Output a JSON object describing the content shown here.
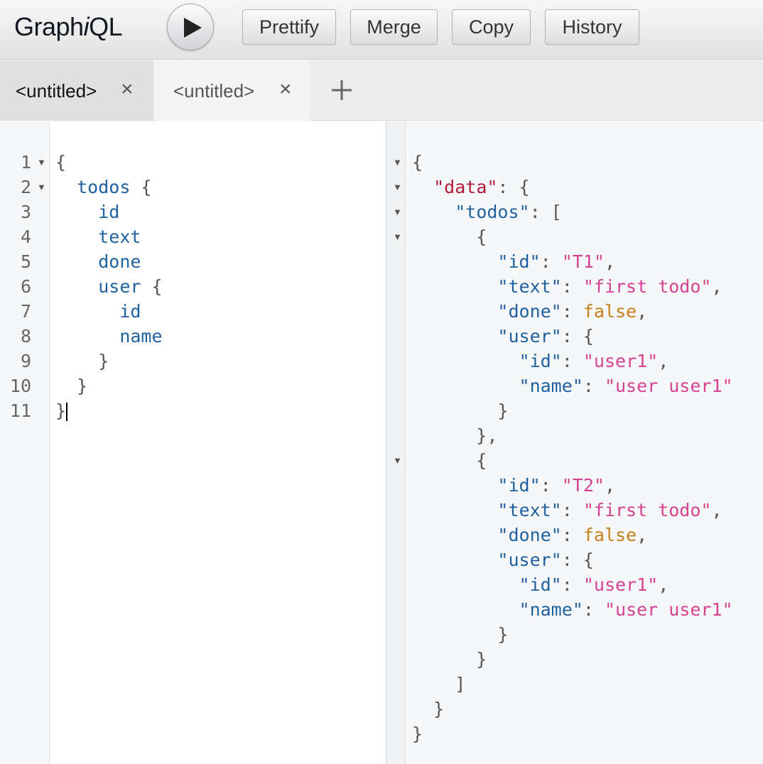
{
  "app": {
    "logo_main": "Graph",
    "logo_i": "i",
    "logo_end": "QL"
  },
  "toolbar": {
    "run_icon": "play-icon",
    "buttons": [
      {
        "label": "Prettify"
      },
      {
        "label": "Merge"
      },
      {
        "label": "Copy"
      },
      {
        "label": "History"
      }
    ]
  },
  "tabs": [
    {
      "label": "<untitled>",
      "close": "×",
      "active": true
    },
    {
      "label": "<untitled>",
      "close": "×",
      "active": false
    }
  ],
  "add_tab_icon": "plus-icon",
  "query_editor": {
    "lines": [
      {
        "num": "1",
        "fold": true,
        "tokens": [
          {
            "t": "{",
            "c": "punc"
          }
        ]
      },
      {
        "num": "2",
        "fold": true,
        "tokens": [
          {
            "t": "  ",
            "c": "punc"
          },
          {
            "t": "todos",
            "c": "field"
          },
          {
            "t": " {",
            "c": "punc"
          }
        ]
      },
      {
        "num": "3",
        "fold": false,
        "tokens": [
          {
            "t": "    ",
            "c": "punc"
          },
          {
            "t": "id",
            "c": "field"
          }
        ]
      },
      {
        "num": "4",
        "fold": false,
        "tokens": [
          {
            "t": "    ",
            "c": "punc"
          },
          {
            "t": "text",
            "c": "field"
          }
        ]
      },
      {
        "num": "5",
        "fold": false,
        "tokens": [
          {
            "t": "    ",
            "c": "punc"
          },
          {
            "t": "done",
            "c": "field"
          }
        ]
      },
      {
        "num": "6",
        "fold": false,
        "tokens": [
          {
            "t": "    ",
            "c": "punc"
          },
          {
            "t": "user",
            "c": "field"
          },
          {
            "t": " {",
            "c": "punc"
          }
        ]
      },
      {
        "num": "7",
        "fold": false,
        "tokens": [
          {
            "t": "      ",
            "c": "punc"
          },
          {
            "t": "id",
            "c": "field"
          }
        ]
      },
      {
        "num": "8",
        "fold": false,
        "tokens": [
          {
            "t": "      ",
            "c": "punc"
          },
          {
            "t": "name",
            "c": "field"
          }
        ]
      },
      {
        "num": "9",
        "fold": false,
        "tokens": [
          {
            "t": "    }",
            "c": "punc"
          }
        ]
      },
      {
        "num": "10",
        "fold": false,
        "tokens": [
          {
            "t": "  }",
            "c": "punc"
          }
        ]
      },
      {
        "num": "11",
        "fold": false,
        "tokens": [
          {
            "t": "}",
            "c": "punc"
          }
        ],
        "cursor": true
      }
    ]
  },
  "result_viewer": {
    "lines": [
      {
        "fold": true,
        "tokens": [
          {
            "t": "{",
            "c": "punc"
          }
        ]
      },
      {
        "fold": true,
        "tokens": [
          {
            "t": "  ",
            "c": "punc"
          },
          {
            "t": "\"data\"",
            "c": "key-data"
          },
          {
            "t": ": {",
            "c": "punc"
          }
        ]
      },
      {
        "fold": true,
        "tokens": [
          {
            "t": "    ",
            "c": "punc"
          },
          {
            "t": "\"todos\"",
            "c": "prop"
          },
          {
            "t": ": [",
            "c": "punc"
          }
        ]
      },
      {
        "fold": true,
        "tokens": [
          {
            "t": "      {",
            "c": "punc"
          }
        ]
      },
      {
        "fold": false,
        "tokens": [
          {
            "t": "        ",
            "c": "punc"
          },
          {
            "t": "\"id\"",
            "c": "prop"
          },
          {
            "t": ": ",
            "c": "punc"
          },
          {
            "t": "\"T1\"",
            "c": "str"
          },
          {
            "t": ",",
            "c": "punc"
          }
        ]
      },
      {
        "fold": false,
        "tokens": [
          {
            "t": "        ",
            "c": "punc"
          },
          {
            "t": "\"text\"",
            "c": "prop"
          },
          {
            "t": ": ",
            "c": "punc"
          },
          {
            "t": "\"first todo\"",
            "c": "str"
          },
          {
            "t": ",",
            "c": "punc"
          }
        ]
      },
      {
        "fold": false,
        "tokens": [
          {
            "t": "        ",
            "c": "punc"
          },
          {
            "t": "\"done\"",
            "c": "prop"
          },
          {
            "t": ": ",
            "c": "punc"
          },
          {
            "t": "false",
            "c": "bool"
          },
          {
            "t": ",",
            "c": "punc"
          }
        ]
      },
      {
        "fold": false,
        "tokens": [
          {
            "t": "        ",
            "c": "punc"
          },
          {
            "t": "\"user\"",
            "c": "prop"
          },
          {
            "t": ": {",
            "c": "punc"
          }
        ]
      },
      {
        "fold": false,
        "tokens": [
          {
            "t": "          ",
            "c": "punc"
          },
          {
            "t": "\"id\"",
            "c": "prop"
          },
          {
            "t": ": ",
            "c": "punc"
          },
          {
            "t": "\"user1\"",
            "c": "str"
          },
          {
            "t": ",",
            "c": "punc"
          }
        ]
      },
      {
        "fold": false,
        "tokens": [
          {
            "t": "          ",
            "c": "punc"
          },
          {
            "t": "\"name\"",
            "c": "prop"
          },
          {
            "t": ": ",
            "c": "punc"
          },
          {
            "t": "\"user user1\"",
            "c": "str"
          }
        ]
      },
      {
        "fold": false,
        "tokens": [
          {
            "t": "        }",
            "c": "punc"
          }
        ]
      },
      {
        "fold": false,
        "tokens": [
          {
            "t": "      },",
            "c": "punc"
          }
        ]
      },
      {
        "fold": true,
        "tokens": [
          {
            "t": "      {",
            "c": "punc"
          }
        ]
      },
      {
        "fold": false,
        "tokens": [
          {
            "t": "        ",
            "c": "punc"
          },
          {
            "t": "\"id\"",
            "c": "prop"
          },
          {
            "t": ": ",
            "c": "punc"
          },
          {
            "t": "\"T2\"",
            "c": "str"
          },
          {
            "t": ",",
            "c": "punc"
          }
        ]
      },
      {
        "fold": false,
        "tokens": [
          {
            "t": "        ",
            "c": "punc"
          },
          {
            "t": "\"text\"",
            "c": "prop"
          },
          {
            "t": ": ",
            "c": "punc"
          },
          {
            "t": "\"first todo\"",
            "c": "str"
          },
          {
            "t": ",",
            "c": "punc"
          }
        ]
      },
      {
        "fold": false,
        "tokens": [
          {
            "t": "        ",
            "c": "punc"
          },
          {
            "t": "\"done\"",
            "c": "prop"
          },
          {
            "t": ": ",
            "c": "punc"
          },
          {
            "t": "false",
            "c": "bool"
          },
          {
            "t": ",",
            "c": "punc"
          }
        ]
      },
      {
        "fold": false,
        "tokens": [
          {
            "t": "        ",
            "c": "punc"
          },
          {
            "t": "\"user\"",
            "c": "prop"
          },
          {
            "t": ": {",
            "c": "punc"
          }
        ]
      },
      {
        "fold": false,
        "tokens": [
          {
            "t": "          ",
            "c": "punc"
          },
          {
            "t": "\"id\"",
            "c": "prop"
          },
          {
            "t": ": ",
            "c": "punc"
          },
          {
            "t": "\"user1\"",
            "c": "str"
          },
          {
            "t": ",",
            "c": "punc"
          }
        ]
      },
      {
        "fold": false,
        "tokens": [
          {
            "t": "          ",
            "c": "punc"
          },
          {
            "t": "\"name\"",
            "c": "prop"
          },
          {
            "t": ": ",
            "c": "punc"
          },
          {
            "t": "\"user user1\"",
            "c": "str"
          }
        ]
      },
      {
        "fold": false,
        "tokens": [
          {
            "t": "        }",
            "c": "punc"
          }
        ]
      },
      {
        "fold": false,
        "tokens": [
          {
            "t": "      }",
            "c": "punc"
          }
        ]
      },
      {
        "fold": false,
        "tokens": [
          {
            "t": "    ]",
            "c": "punc"
          }
        ]
      },
      {
        "fold": false,
        "tokens": [
          {
            "t": "  }",
            "c": "punc"
          }
        ]
      },
      {
        "fold": false,
        "tokens": [
          {
            "t": "}",
            "c": "punc"
          }
        ]
      }
    ]
  },
  "colors": {
    "field": "#1f61a0",
    "data_key": "#b21b39",
    "string": "#d64292",
    "boolean": "#c77f19",
    "punctuation": "#555555"
  }
}
